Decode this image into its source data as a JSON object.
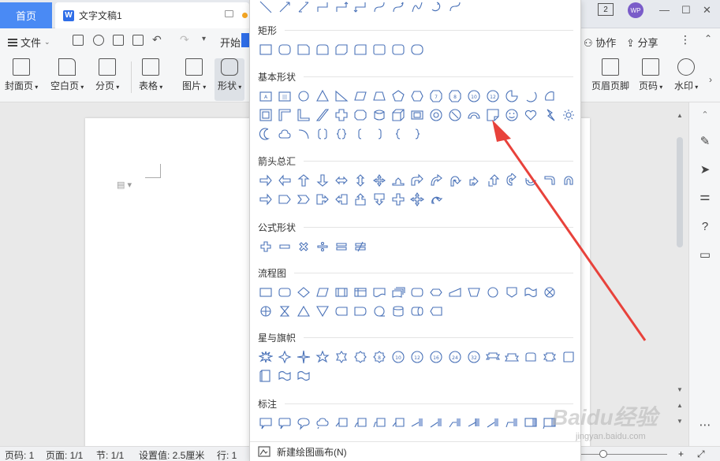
{
  "titlebar": {
    "home_tab": "首页",
    "doc_tab": "文字文稿1",
    "badge_count": "2",
    "avatar_text": "WP"
  },
  "toolbar": {
    "file_label": "文件",
    "start_label": "开始",
    "collab_label": "协作",
    "share_label": "分享"
  },
  "ribbon": {
    "items_left": [
      {
        "label": "封面页",
        "icon": "cover-page-icon"
      },
      {
        "label": "空白页",
        "icon": "blank-page-icon"
      },
      {
        "label": "分页",
        "icon": "page-break-icon"
      },
      {
        "label": "表格",
        "icon": "table-icon"
      },
      {
        "label": "图片",
        "icon": "picture-icon"
      },
      {
        "label": "形状",
        "icon": "shape-icon"
      }
    ],
    "items_right": [
      {
        "label": "页眉页脚",
        "icon": "header-footer-icon"
      },
      {
        "label": "页码",
        "icon": "page-number-icon"
      },
      {
        "label": "水印",
        "icon": "watermark-icon"
      }
    ]
  },
  "dropdown": {
    "sections": [
      {
        "title": "矩形"
      },
      {
        "title": "基本形状"
      },
      {
        "title": "箭头总汇"
      },
      {
        "title": "公式形状"
      },
      {
        "title": "流程图"
      },
      {
        "title": "星与旗帜"
      },
      {
        "title": "标注"
      }
    ],
    "footer_label": "新建绘图画布(N)"
  },
  "status": {
    "page_num": "页码: 1",
    "pages": "页面: 1/1",
    "section": "节: 1/1",
    "setting": "设置值: 2.5厘米",
    "row": "行: 1"
  },
  "watermark": {
    "main": "Baidu经验",
    "sub": "jingyan.baidu.com"
  },
  "colors": {
    "accent": "#4a8af4",
    "shape_stroke": "#4a72b8",
    "arrow": "#e8423b"
  }
}
